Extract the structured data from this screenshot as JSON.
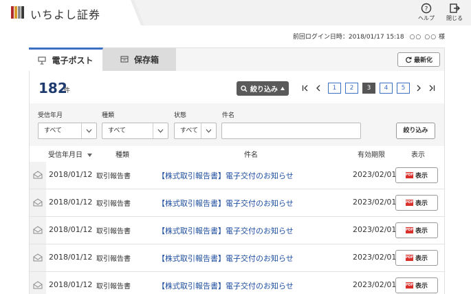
{
  "header": {
    "logo_text": "いちよし証券",
    "logo_colors": [
      "#b22b2b",
      "#d89a2a",
      "#8c8c8c",
      "#3a3a3a"
    ],
    "help_label": "ヘルプ",
    "close_label": "閉じる"
  },
  "login": {
    "label": "前回ログイン日時：2018/01/17 15:18",
    "name": "○○ ○○",
    "honorific": "様"
  },
  "tabs": [
    {
      "label": "電子ポスト",
      "active": true
    },
    {
      "label": "保存箱",
      "active": false
    }
  ],
  "refresh_label": "最新化",
  "count": {
    "value": "182",
    "unit": "件"
  },
  "narrow_button": "絞り込み",
  "pager": {
    "pages": [
      "1",
      "2",
      "3",
      "4",
      "5"
    ],
    "current": "3"
  },
  "filters": {
    "received_label": "受信年月",
    "received_value": "すべて",
    "kind_label": "種類",
    "kind_value": "すべて",
    "state_label": "状態",
    "state_value": "すべて",
    "name_label": "件名",
    "name_value": "",
    "apply_label": "絞り込み"
  },
  "columns": {
    "date": "受信年月日",
    "kind": "種類",
    "title": "件名",
    "expire": "有効期限",
    "view": "表示"
  },
  "rows": [
    {
      "date": "2018/01/12",
      "kind": "取引報告書",
      "title": "【株式取引報告書】電子交付のお知らせ",
      "expire": "2023/02/01",
      "view": "表示"
    },
    {
      "date": "2018/01/12",
      "kind": "取引報告書",
      "title": "【株式取引報告書】電子交付のお知らせ",
      "expire": "2023/02/01",
      "view": "表示"
    },
    {
      "date": "2018/01/12",
      "kind": "取引報告書",
      "title": "【株式取引報告書】電子交付のお知らせ",
      "expire": "2023/02/01",
      "view": "表示"
    },
    {
      "date": "2018/01/12",
      "kind": "取引報告書",
      "title": "【株式取引報告書】電子交付のお知らせ",
      "expire": "2023/02/01",
      "view": "表示"
    },
    {
      "date": "2018/01/12",
      "kind": "取引報告書",
      "title": "【株式取引報告書】電子交付のお知らせ",
      "expire": "2023/02/01",
      "view": "表示"
    }
  ],
  "pdf_badge": "PDF",
  "colors": {
    "accent": "#3a6fc4",
    "link": "#1f4fa0",
    "count": "#1e3a6e",
    "pdf": "#d9302c"
  }
}
